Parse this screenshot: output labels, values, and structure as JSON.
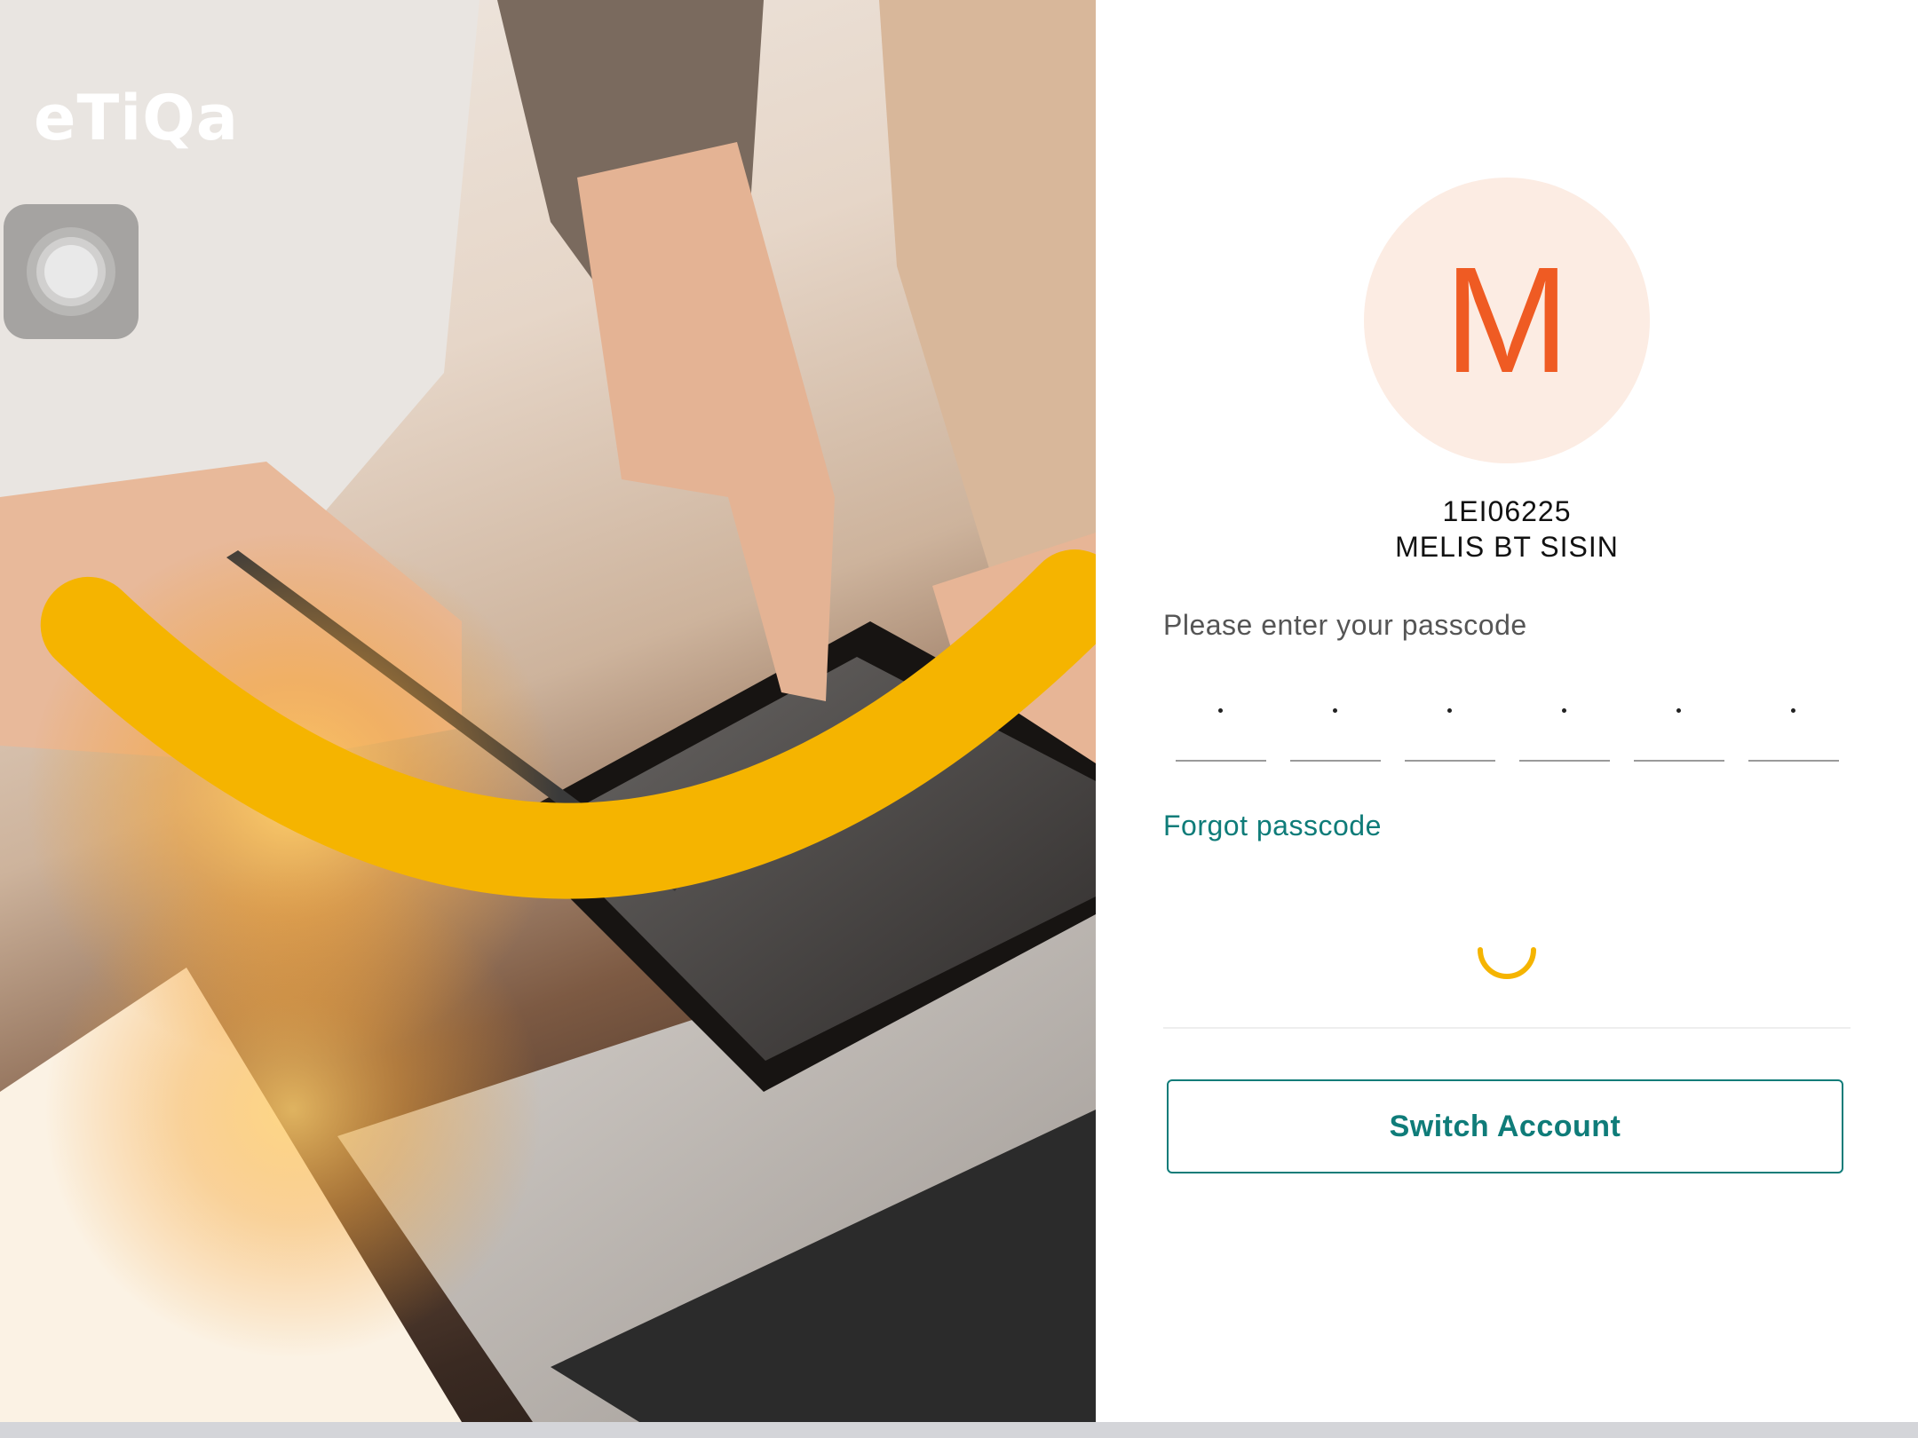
{
  "brand": {
    "logo_text": "eTiQa",
    "colors": {
      "accent_teal": "#0f7c79",
      "avatar_letter": "#ef5b23",
      "avatar_bg": "#fcece3",
      "smile_yellow": "#f5b400"
    }
  },
  "icons": {
    "assistive_touch": "assistive-touch-icon",
    "loading": "loading-spinner-icon"
  },
  "account": {
    "avatar_letter": "M",
    "id": "1EI06225",
    "name": "MELIS BT SISIN"
  },
  "login": {
    "prompt": "Please enter your passcode",
    "passcode_digits": 6,
    "passcode_mask": [
      "•",
      "•",
      "•",
      "•",
      "•",
      "•"
    ],
    "forgot_label": "Forgot passcode",
    "switch_account_label": "Switch Account"
  }
}
